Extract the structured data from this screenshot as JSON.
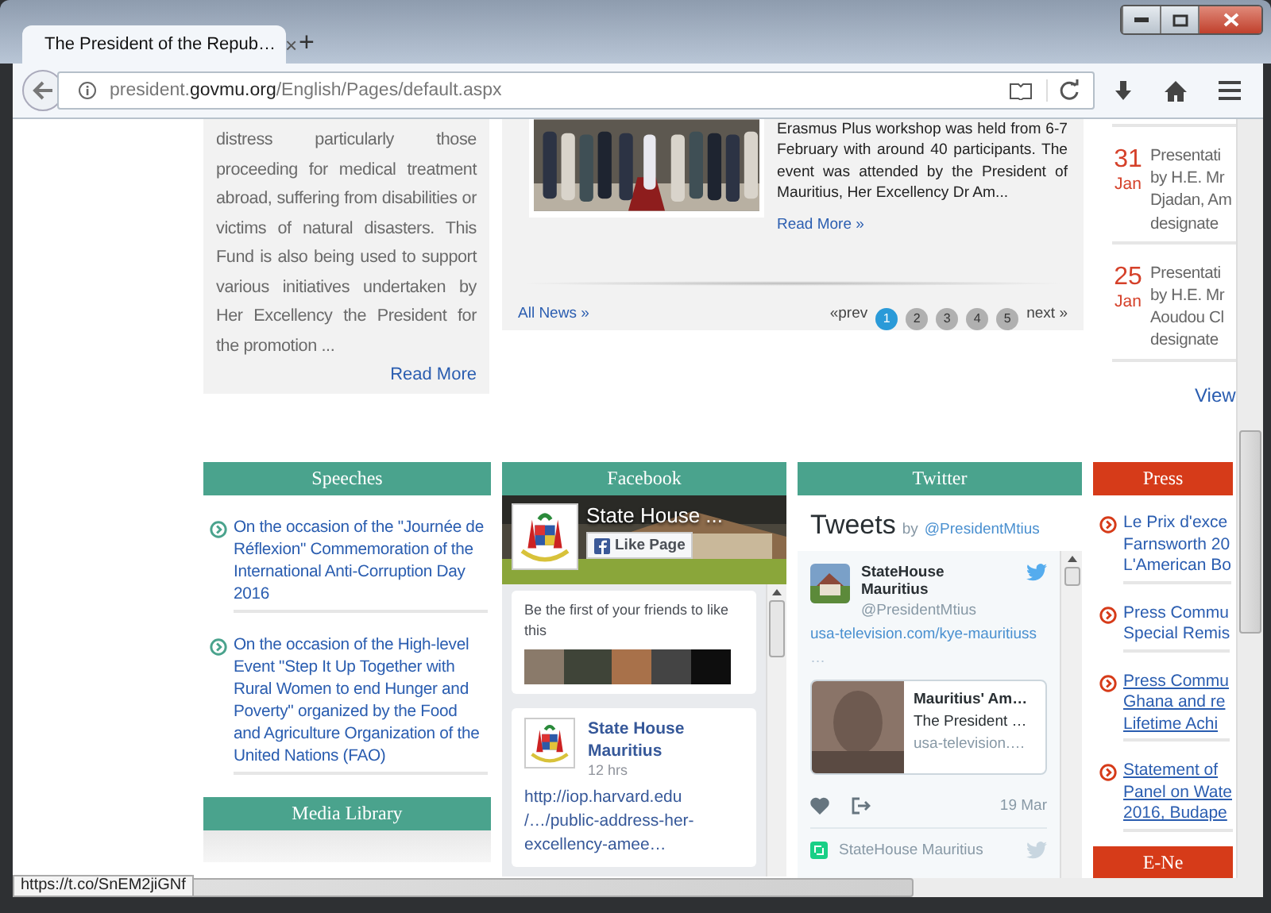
{
  "browser": {
    "tab_title": "The President of the Repub…",
    "tab_close": "×",
    "new_tab": "+",
    "url": {
      "host_start": "president.",
      "domain": "govmu.org",
      "path": "/English/Pages/default.aspx"
    },
    "status_link": "https://t.co/SnEM2jiGNf"
  },
  "intro": {
    "text": "distress particularly those proceeding for medical treatment abroad, suffering from disabilities or victims of natural disasters. This Fund is also being used to support various initiatives undertaken by Her Excellency the President for the promotion  ...",
    "read_more": "Read More"
  },
  "news": {
    "text": "Erasmus Plus workshop was held from 6-7 February with around 40 participants. The event was attended by the President of Mauritius, Her Excellency Dr Am...",
    "read_more": "Read More »",
    "all_news": "All News »",
    "prev": "«prev",
    "next": "next »",
    "pages": [
      {
        "label": "1",
        "selected": true
      },
      {
        "label": "2",
        "selected": false
      },
      {
        "label": "3",
        "selected": false
      },
      {
        "label": "4",
        "selected": false
      },
      {
        "label": "5",
        "selected": false
      }
    ]
  },
  "events": {
    "items": [
      {
        "day": "31",
        "month": "Jan",
        "text": "Presentati\nby H.E. Mr\nDjadan, Am\ndesignate"
      },
      {
        "day": "25",
        "month": "Jan",
        "text": "Presentati\nby H.E. Mr\nAoudou Cl\ndesignate"
      }
    ],
    "view": "View"
  },
  "speeches": {
    "title": "Speeches",
    "items": [
      "On the occasion of the \"Journée de Réflexion\" Commemoration of the International Anti-Corruption Day 2016",
      "On the occasion of the High-level Event \"Step It Up Together with Rural Women to end Hunger and Poverty\" organized by the Food and Agriculture Organization of the United Nations (FAO)"
    ]
  },
  "media_library": {
    "title": "Media Library"
  },
  "facebook": {
    "title": "Facebook",
    "page_name": "State House ...",
    "like": "Like Page",
    "friends_text": "Be the first of your friends to like this",
    "post": {
      "author": "State House Mauritius",
      "time": "12 hrs",
      "link": "http://iop.harvard.edu /…/public-address-her-excellency-amee…"
    }
  },
  "twitter": {
    "title": "Twitter",
    "heading": "Tweets",
    "by": "by",
    "handle": "@PresidentMtius",
    "tweet": {
      "name": "StateHouse Mauritius",
      "handle": "@PresidentMtius",
      "link": "usa-television.com/kye-mauritiuss",
      "more": "…",
      "card_title": "Mauritius' Am…",
      "card_text": "The President …",
      "card_domain": "usa-television.…",
      "date": "19 Mar"
    },
    "retweet": {
      "name": "StateHouse Mauritius"
    }
  },
  "press": {
    "title": "Press",
    "items": [
      {
        "text": "Le Prix d'exce\nFarnsworth 20\nL'American Bo",
        "underlined": false
      },
      {
        "text": "Press Commu\nSpecial Remis",
        "underlined": false
      },
      {
        "text": "Press Commu\nGhana and re\nLifetime Achi",
        "underlined": true
      },
      {
        "text": "Statement of\nPanel on Wate\n2016, Budape",
        "underlined": true
      }
    ]
  },
  "enews": {
    "title": "E-Ne"
  }
}
